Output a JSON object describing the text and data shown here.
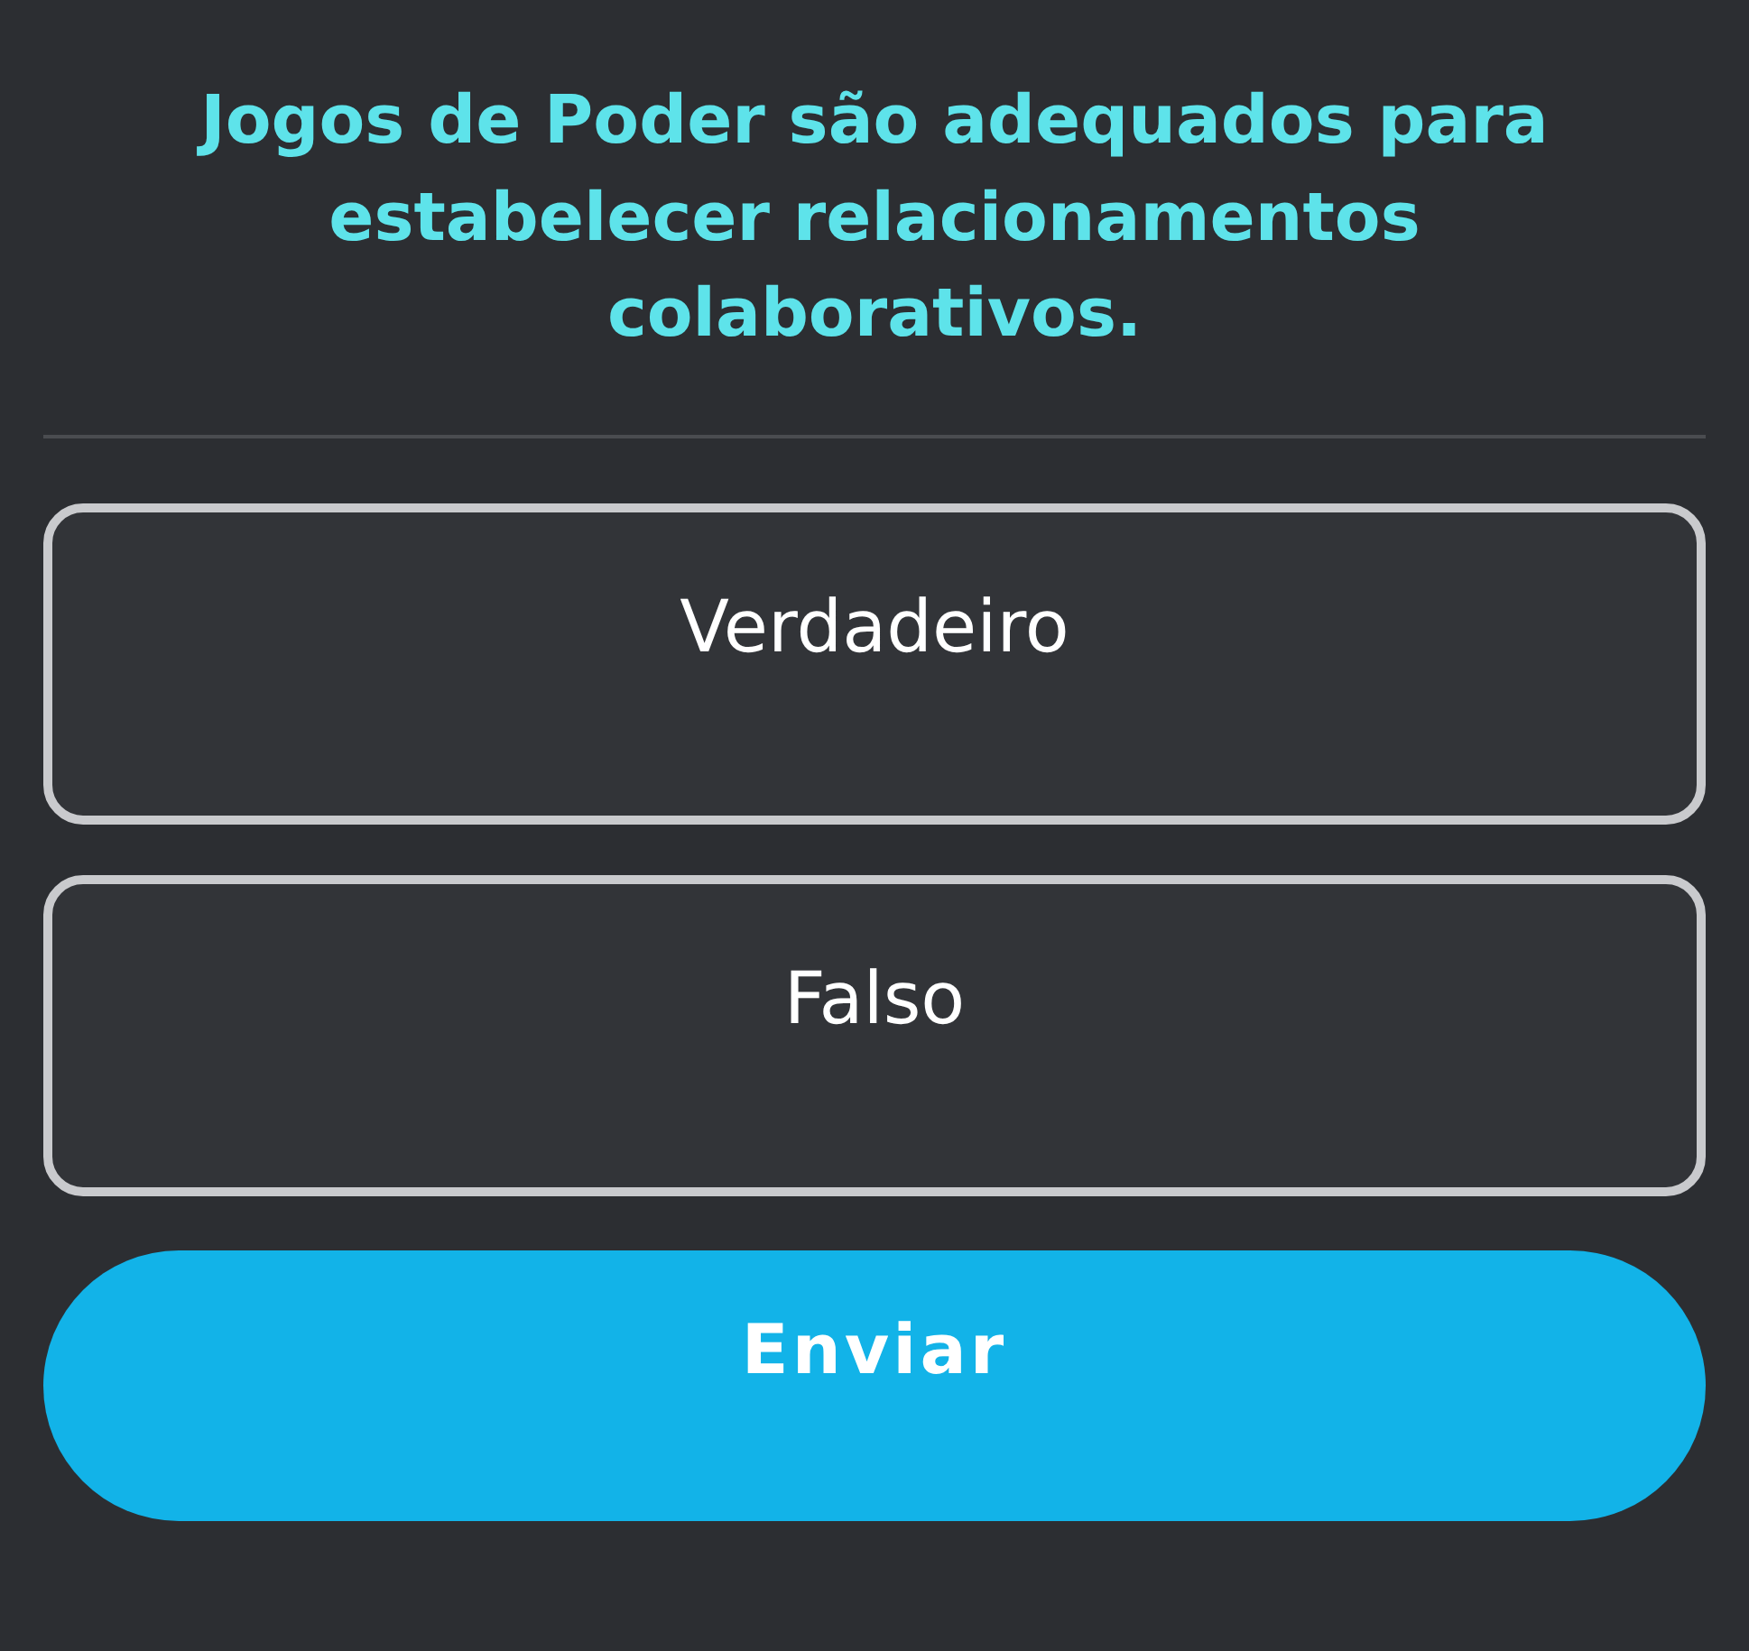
{
  "question": {
    "text": "Jogos de Poder são adequados para estabelecer relacionamentos colaborativos."
  },
  "options": [
    {
      "label": "Verdadeiro",
      "selected": false
    },
    {
      "label": "Falso",
      "selected": false
    }
  ],
  "submit_button": {
    "label": "Enviar"
  }
}
